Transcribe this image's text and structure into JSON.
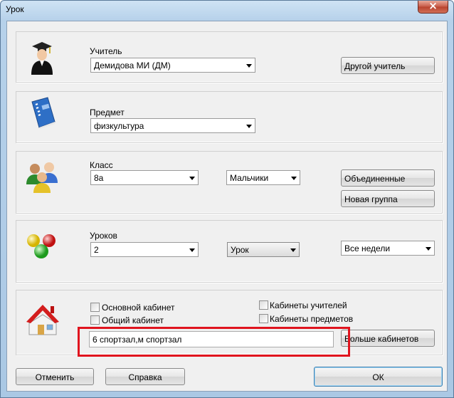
{
  "window": {
    "title": "Урок",
    "close_glyph": "×"
  },
  "teacher": {
    "label": "Учитель",
    "value": "Демидова МИ (ДМ)",
    "other_button": "Другой учитель",
    "icon": "teacher-icon"
  },
  "subject": {
    "label": "Предмет",
    "value": "физкультура",
    "icon": "book-icon"
  },
  "klass": {
    "label": "Класс",
    "value": "8а",
    "group_value": "Мальчики",
    "merged_button": "Объединенные",
    "new_group_button": "Новая группа",
    "icon": "students-icon"
  },
  "lessons": {
    "label": "Уроков",
    "count_value": "2",
    "type_value": "Урок",
    "weeks_value": "Все недели",
    "icon": "balls-icon"
  },
  "rooms": {
    "icon": "house-icon",
    "main_room": "Основной кабинет",
    "common_room": "Общий кабинет",
    "teacher_rooms": "Кабинеты учителей",
    "subject_rooms": "Кабинеты предметов",
    "selected": "6 спортзал,м спортзал",
    "more_button": "Больше кабинетов"
  },
  "footer": {
    "cancel": "Отменить",
    "help": "Справка",
    "ok": "ОК"
  },
  "colors": {
    "highlight": "#e0141e",
    "title_bar": "#b6d1ea"
  }
}
